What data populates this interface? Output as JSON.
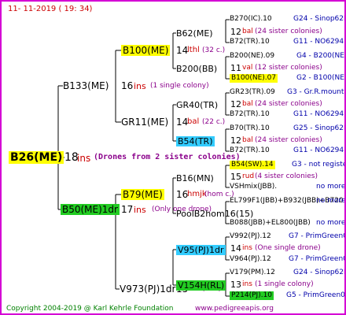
{
  "header": {
    "timestamp": "11- 11-2019 ( 19: 34)"
  },
  "footer": {
    "copyright": "Copyright 2004-2019 @ Karl Kehrle Foundation",
    "url": "www.pedigreeapis.org"
  },
  "colors": {
    "frame": "#d400d4",
    "highlight_yellow": "#ffff00",
    "highlight_green": "#22cc22",
    "highlight_cyan": "#33ccff",
    "gen_text": "#cc0000",
    "line_text": "#0000aa"
  },
  "root": {
    "name": "B26(ME)",
    "gen": "18",
    "ins": "ins",
    "note": "(Drones from 2 sister colonies)"
  },
  "dam": {
    "name": "B133(ME)",
    "gen": "16",
    "ins": "ins",
    "note": "(1 single colony)",
    "dam": {
      "name": "B100(ME)",
      "gen": "14",
      "ins": "lthl",
      "note": "(32 c.)",
      "dam": {
        "name": "B62(ME)",
        "gen": "12",
        "ins": "bal",
        "note": "(24 sister colonies)",
        "sire": "B270(IC).10",
        "sire_line": "G24 - Sinop62R",
        "dam": "B72(TR).10",
        "dam_line": "G11 - NO6294R"
      },
      "sire": {
        "name": "B200(BB)",
        "gen": "11",
        "ins": "val",
        "note": "(12 sister colonies)",
        "sire": "B200(NE).09",
        "sire_line": "G4 - B200(NE)",
        "dam": "B100(NE).07",
        "dam_line": "G2 - B100(NE)"
      }
    },
    "sire": {
      "name": "GR11(ME)",
      "gen": "14",
      "ins": "bal",
      "note": "(22 c.)",
      "dam": {
        "name": "GR40(TR)",
        "gen": "12",
        "ins": "bal",
        "note": "(24 sister colonies)",
        "sire": "GR23(TR).09",
        "sire_line": "G3 - Gr.R.mounta",
        "dam": "B72(TR).10",
        "dam_line": "G11 - NO6294R"
      },
      "sire": {
        "name": "B54(TR)",
        "gen": "12",
        "ins": "bal",
        "note": "(24 sister colonies)",
        "sire": "B70(TR).10",
        "sire_line": "G25 - Sinop62R",
        "dam": "B72(TR).10",
        "dam_line": "G11 - NO6294R"
      }
    }
  },
  "sire": {
    "name": "B50(ME)1dr",
    "gen": "17",
    "ins": "ins",
    "note": "(Only one drone)",
    "dam": {
      "name": "B79(ME)",
      "gen": "16",
      "ins": "hmjk",
      "note": "(hom c.)",
      "dam": {
        "name": "B16(MN)",
        "gen": "15",
        "ins": "rud",
        "note": "(4 sister colonies)",
        "sire": "B54(SW).14",
        "sire_line": "G3 - not registe",
        "dam": "VSHmix(JBB).",
        "dam_line": "no more"
      },
      "sire": {
        "name": "PoolB2hom16(15)",
        "gen": "",
        "ins": "",
        "note": "",
        "sire": "EL799F1(JBB)+B932(JBB)+B720",
        "sire_line": "no more",
        "dam": "B088(JBB)+EL800(JBB)",
        "dam_line": "no more"
      }
    },
    "sire": {
      "name": "V973(PJ)1dr",
      "gen": "15",
      "ins": "ins",
      "note": "(1dr.)",
      "dam": {
        "name": "V95(PJ)1dr",
        "gen": "14",
        "ins": "ins",
        "note": "(One single drone)",
        "sire": "V992(PJ).12",
        "sire_line": "G7 - PrimGreen00",
        "dam": "V964(PJ).12",
        "dam_line": "G7 - PrimGreen00"
      },
      "sire": {
        "name": "V154H(RL)",
        "gen": "13",
        "ins": "ins",
        "note": "(1 single colony)",
        "sire": "V179(PM).12",
        "sire_line": "G24 - Sinop62R",
        "dam": "P214(PJ).10",
        "dam_line": "G5 - PrimGreen00"
      }
    }
  }
}
